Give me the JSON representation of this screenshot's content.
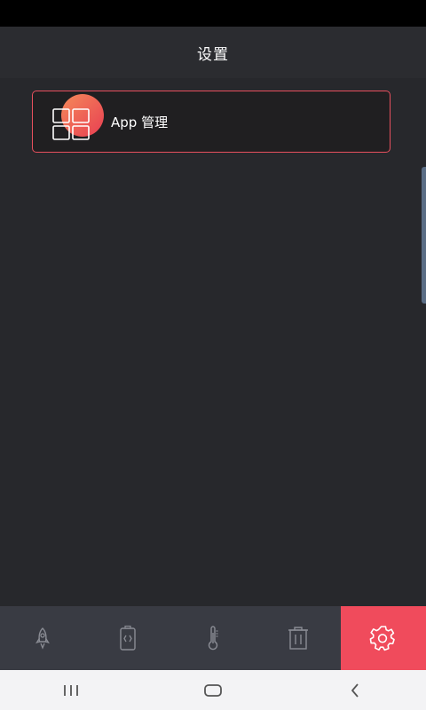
{
  "header": {
    "title": "设置"
  },
  "settings_list": {
    "items": [
      {
        "icon": "app-grid-icon",
        "label": "App 管理"
      }
    ]
  },
  "tab_bar": {
    "tabs": [
      {
        "icon": "rocket-icon",
        "active": false
      },
      {
        "icon": "battery-icon",
        "active": false
      },
      {
        "icon": "thermometer-icon",
        "active": false
      },
      {
        "icon": "trash-icon",
        "active": false
      },
      {
        "icon": "gear-icon",
        "active": true
      }
    ]
  },
  "nav_bar": {
    "buttons": [
      {
        "icon": "recent-apps-icon"
      },
      {
        "icon": "home-icon"
      },
      {
        "icon": "back-icon"
      }
    ]
  },
  "colors": {
    "accent": "#f04b5c",
    "background": "#27282c",
    "tab_bar": "#393b43",
    "card_border": "#e8505e"
  }
}
